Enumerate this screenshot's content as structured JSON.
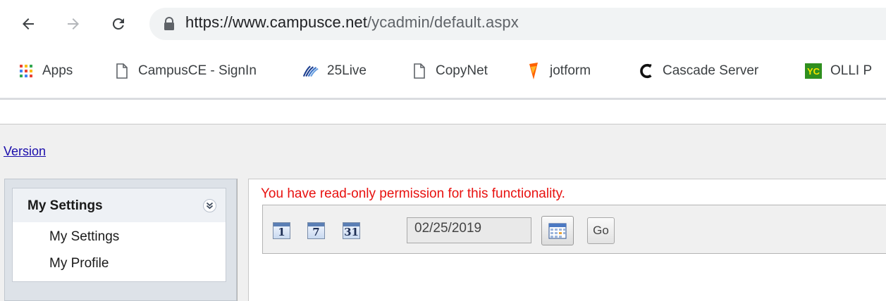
{
  "browser": {
    "url": {
      "host": "https://www.campusce.net",
      "path": "/ycadmin/default.aspx"
    },
    "bookmarks": [
      {
        "label": "Apps",
        "icon": "apps-grid-icon"
      },
      {
        "label": "CampusCE - SignIn",
        "icon": "page-icon"
      },
      {
        "label": "25Live",
        "icon": "25live-logo-icon"
      },
      {
        "label": "CopyNet",
        "icon": "page-icon"
      },
      {
        "label": "jotform",
        "icon": "jotform-logo-icon"
      },
      {
        "label": "Cascade Server",
        "icon": "cascade-logo-icon"
      },
      {
        "label": "OLLI P",
        "icon": "yc-logo-icon"
      }
    ],
    "yc_badge": "YC"
  },
  "page": {
    "version_link": "Version",
    "sidebar": {
      "title": "My Settings",
      "items": [
        "My Settings",
        "My Profile"
      ]
    },
    "main": {
      "permission_message": "You have read-only permission for this functionality.",
      "view_icons": [
        "1",
        "7",
        "31"
      ],
      "date_value": "02/25/2019",
      "go_label": "Go"
    }
  },
  "colors": {
    "message_red": "#e8110f",
    "link_blue": "#1a0dab",
    "panel_gray": "#f0f0f0"
  }
}
